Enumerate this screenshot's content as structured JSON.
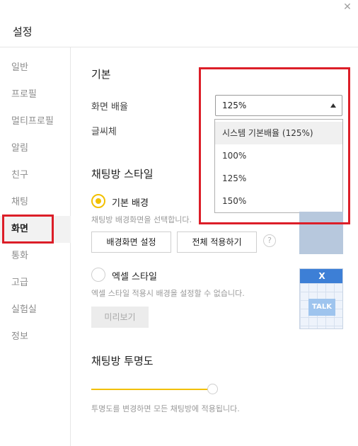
{
  "window": {
    "title": "설정",
    "close_symbol": "✕"
  },
  "sidebar": {
    "items": [
      {
        "label": "일반",
        "active": false
      },
      {
        "label": "프로필",
        "active": false
      },
      {
        "label": "멀티프로필",
        "active": false
      },
      {
        "label": "알림",
        "active": false
      },
      {
        "label": "친구",
        "active": false
      },
      {
        "label": "채팅",
        "active": false
      },
      {
        "label": "화면",
        "active": true
      },
      {
        "label": "통화",
        "active": false
      },
      {
        "label": "고급",
        "active": false
      },
      {
        "label": "실험실",
        "active": false
      },
      {
        "label": "정보",
        "active": false
      }
    ]
  },
  "basic": {
    "title": "기본",
    "zoom_label": "화면 배율",
    "zoom_value": "125%",
    "font_label": "글씨체",
    "dropdown_options": [
      "시스템 기본배율 (125%)",
      "100%",
      "125%",
      "150%"
    ],
    "dropdown_highlighted": "시스템 기본배율 (125%)"
  },
  "chat_style": {
    "title": "채팅방 스타일",
    "default_bg_label": "기본 배경",
    "default_bg_selected": true,
    "default_bg_hint": "채팅방 배경화면을 선택합니다.",
    "set_bg_button": "배경화면 설정",
    "apply_all_button": "전체 적용하기",
    "help_symbol": "?",
    "excel_label": "엑셀 스타일",
    "excel_selected": false,
    "excel_hint": "엑셀 스타일 적용시 배경을 설정할 수 없습니다.",
    "preview_button": "미리보기",
    "excel_preview_x": "X",
    "excel_preview_talk": "TALK"
  },
  "transparency": {
    "title": "채팅방 투명도",
    "level": 1.0,
    "hint": "투명도를 변경하면 모든 채팅방에 적용됩니다."
  },
  "colors": {
    "accent_yellow": "#f2c000",
    "highlight_red": "#dc1e28",
    "preview_blue": "#b7c8dd",
    "excel_blue": "#3d7fd6"
  }
}
